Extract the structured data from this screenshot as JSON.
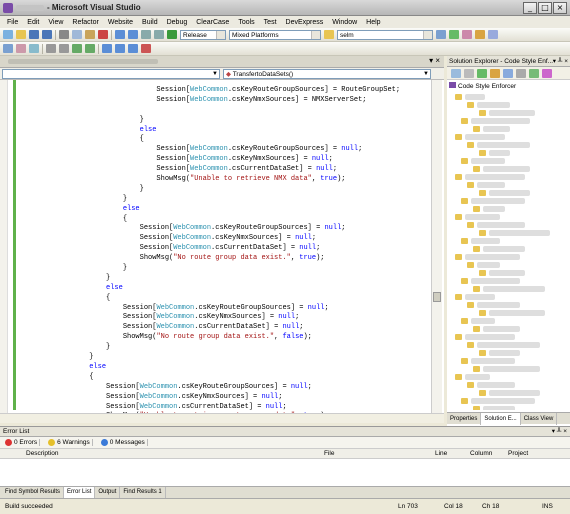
{
  "window": {
    "title": "- Microsoft Visual Studio"
  },
  "menu": [
    "File",
    "Edit",
    "View",
    "Refactor",
    "Website",
    "Build",
    "Debug",
    "ClearCase",
    "Tools",
    "Test",
    "DevExpress",
    "Window",
    "Help"
  ],
  "toolbar": {
    "config": "Release",
    "platform": "Mixed Platforms",
    "find": "selm"
  },
  "editor": {
    "method_combo": "TransfertoDataSets()"
  },
  "code_lines": [
    {
      "i": 16,
      "t": [
        [
          "Session[",
          ""
        ],
        [
          "WebCommon",
          "ty"
        ],
        [
          ".csKeyRouteGroupSources] = RouteGroupSet;",
          ""
        ]
      ]
    },
    {
      "i": 16,
      "t": [
        [
          "Session[",
          ""
        ],
        [
          "WebCommon",
          "ty"
        ],
        [
          ".csKeyNmxSources] = NMXServerSet;",
          ""
        ]
      ]
    },
    {
      "i": 0,
      "t": []
    },
    {
      "i": 14,
      "t": [
        [
          "}",
          ""
        ]
      ]
    },
    {
      "i": 14,
      "t": [
        [
          "else",
          "kw"
        ]
      ]
    },
    {
      "i": 14,
      "t": [
        [
          "{",
          ""
        ]
      ]
    },
    {
      "i": 16,
      "t": [
        [
          "Session[",
          ""
        ],
        [
          "WebCommon",
          "ty"
        ],
        [
          ".csKeyRouteGroupSources] = ",
          ""
        ],
        [
          "null",
          "kw"
        ],
        [
          ";",
          ""
        ]
      ]
    },
    {
      "i": 16,
      "t": [
        [
          "Session[",
          ""
        ],
        [
          "WebCommon",
          "ty"
        ],
        [
          ".csKeyNmxSources] = ",
          ""
        ],
        [
          "null",
          "kw"
        ],
        [
          ";",
          ""
        ]
      ]
    },
    {
      "i": 16,
      "t": [
        [
          "Session[",
          ""
        ],
        [
          "WebCommon",
          "ty"
        ],
        [
          ".csCurrentDataSet] = ",
          ""
        ],
        [
          "null",
          "kw"
        ],
        [
          ";",
          ""
        ]
      ]
    },
    {
      "i": 16,
      "t": [
        [
          "ShowMsg(",
          ""
        ],
        [
          "\"Unable to retrieve NMX data\"",
          "str"
        ],
        [
          ", ",
          ""
        ],
        [
          "true",
          "kw"
        ],
        [
          ");",
          ""
        ]
      ]
    },
    {
      "i": 14,
      "t": [
        [
          "}",
          ""
        ]
      ]
    },
    {
      "i": 12,
      "t": [
        [
          "}",
          ""
        ]
      ]
    },
    {
      "i": 12,
      "t": [
        [
          "else",
          "kw"
        ]
      ]
    },
    {
      "i": 12,
      "t": [
        [
          "{",
          ""
        ]
      ]
    },
    {
      "i": 14,
      "t": [
        [
          "Session[",
          ""
        ],
        [
          "WebCommon",
          "ty"
        ],
        [
          ".csKeyRouteGroupSources] = ",
          ""
        ],
        [
          "null",
          "kw"
        ],
        [
          ";",
          ""
        ]
      ]
    },
    {
      "i": 14,
      "t": [
        [
          "Session[",
          ""
        ],
        [
          "WebCommon",
          "ty"
        ],
        [
          ".csKeyNmxSources] = ",
          ""
        ],
        [
          "null",
          "kw"
        ],
        [
          ";",
          ""
        ]
      ]
    },
    {
      "i": 14,
      "t": [
        [
          "Session[",
          ""
        ],
        [
          "WebCommon",
          "ty"
        ],
        [
          ".csCurrentDataSet] = ",
          ""
        ],
        [
          "null",
          "kw"
        ],
        [
          ";",
          ""
        ]
      ]
    },
    {
      "i": 14,
      "t": [
        [
          "ShowMsg(",
          ""
        ],
        [
          "\"No route group data exist.\"",
          "str"
        ],
        [
          ", ",
          ""
        ],
        [
          "true",
          "kw"
        ],
        [
          ");",
          ""
        ]
      ]
    },
    {
      "i": 12,
      "t": [
        [
          "}",
          ""
        ]
      ]
    },
    {
      "i": 10,
      "t": [
        [
          "}",
          ""
        ]
      ]
    },
    {
      "i": 10,
      "t": [
        [
          "else",
          "kw"
        ]
      ]
    },
    {
      "i": 10,
      "t": [
        [
          "{",
          ""
        ]
      ]
    },
    {
      "i": 12,
      "t": [
        [
          "Session[",
          ""
        ],
        [
          "WebCommon",
          "ty"
        ],
        [
          ".csKeyRouteGroupSources] = ",
          ""
        ],
        [
          "null",
          "kw"
        ],
        [
          ";",
          ""
        ]
      ]
    },
    {
      "i": 12,
      "t": [
        [
          "Session[",
          ""
        ],
        [
          "WebCommon",
          "ty"
        ],
        [
          ".csKeyNmxSources] = ",
          ""
        ],
        [
          "null",
          "kw"
        ],
        [
          ";",
          ""
        ]
      ]
    },
    {
      "i": 12,
      "t": [
        [
          "Session[",
          ""
        ],
        [
          "WebCommon",
          "ty"
        ],
        [
          ".csCurrentDataSet] = ",
          ""
        ],
        [
          "null",
          "kw"
        ],
        [
          ";",
          ""
        ]
      ]
    },
    {
      "i": 12,
      "t": [
        [
          "ShowMsg(",
          ""
        ],
        [
          "\"No route group data exist.\"",
          "str"
        ],
        [
          ", ",
          ""
        ],
        [
          "false",
          "kw"
        ],
        [
          ");",
          ""
        ]
      ]
    },
    {
      "i": 10,
      "t": [
        [
          "}",
          ""
        ]
      ]
    },
    {
      "i": 8,
      "t": [
        [
          "}",
          ""
        ]
      ]
    },
    {
      "i": 8,
      "t": [
        [
          "else",
          "kw"
        ]
      ]
    },
    {
      "i": 8,
      "t": [
        [
          "{",
          ""
        ]
      ]
    },
    {
      "i": 10,
      "t": [
        [
          "Session[",
          ""
        ],
        [
          "WebCommon",
          "ty"
        ],
        [
          ".csKeyRouteGroupSources] = ",
          ""
        ],
        [
          "null",
          "kw"
        ],
        [
          ";",
          ""
        ]
      ]
    },
    {
      "i": 10,
      "t": [
        [
          "Session[",
          ""
        ],
        [
          "WebCommon",
          "ty"
        ],
        [
          ".csKeyNmxSources] = ",
          ""
        ],
        [
          "null",
          "kw"
        ],
        [
          ";",
          ""
        ]
      ]
    },
    {
      "i": 10,
      "t": [
        [
          "Session[",
          ""
        ],
        [
          "WebCommon",
          "ty"
        ],
        [
          ".csCurrentDataSet] = ",
          ""
        ],
        [
          "null",
          "kw"
        ],
        [
          ";",
          ""
        ]
      ]
    },
    {
      "i": 10,
      "t": [
        [
          "ShowMsg(",
          ""
        ],
        [
          "\"Unable to retrieve route group data\"",
          "str"
        ],
        [
          ", ",
          ""
        ],
        [
          "true",
          "kw"
        ],
        [
          ");",
          ""
        ]
      ]
    },
    {
      "i": 8,
      "t": [
        [
          "}",
          ""
        ]
      ]
    }
  ],
  "solution_explorer": {
    "title": "Solution Explorer - Code Style Enf...",
    "root": "Code Style Enforcer",
    "tabs": [
      "Properties",
      "Solution E...",
      "Class View"
    ]
  },
  "error_list": {
    "title": "Error List",
    "errors": "0 Errors",
    "warnings": "6 Warnings",
    "messages": "0 Messages",
    "columns": [
      "Description",
      "File",
      "Line",
      "Column",
      "Project"
    ]
  },
  "bottom_tabs": [
    "Find Symbol Results",
    "Error List",
    "Output",
    "Find Results 1"
  ],
  "status": {
    "message": "Build succeeded",
    "ln": "Ln 703",
    "col": "Col 18",
    "ch": "Ch 18",
    "mode": "INS"
  }
}
